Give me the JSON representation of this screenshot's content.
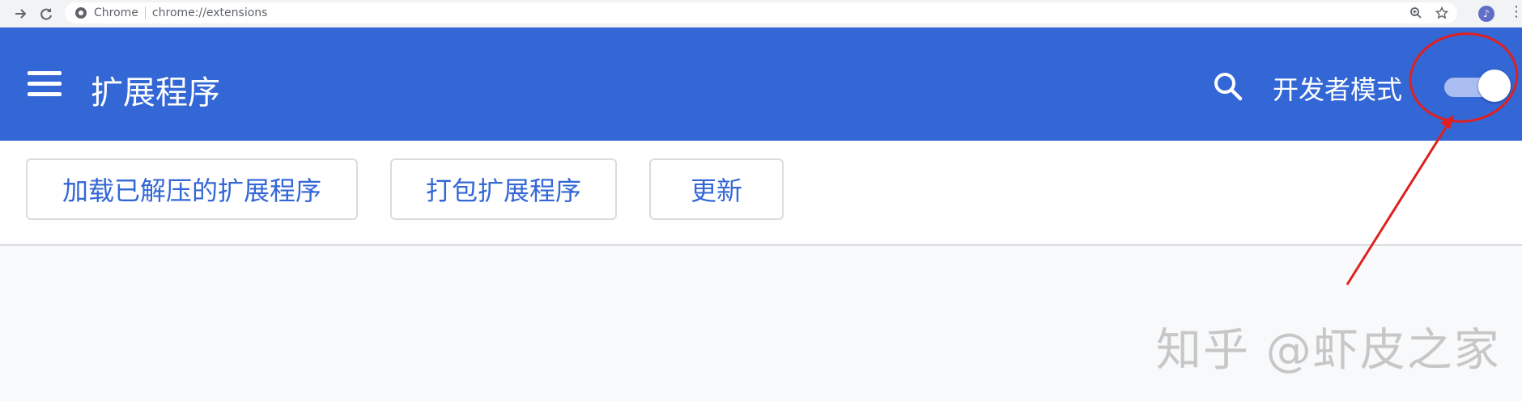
{
  "browser": {
    "site_label": "Chrome",
    "url": "chrome://extensions",
    "avatar_glyph": "♪"
  },
  "header": {
    "title": "扩展程序",
    "dev_mode_label": "开发者模式",
    "dev_mode_enabled": true,
    "accent_color": "#3367d6"
  },
  "toolbar": {
    "load_unpacked_label": "加载已解压的扩展程序",
    "pack_label": "打包扩展程序",
    "update_label": "更新"
  },
  "watermark": {
    "text": "知乎 @虾皮之家"
  },
  "annotation": {
    "color": "#e02020"
  }
}
